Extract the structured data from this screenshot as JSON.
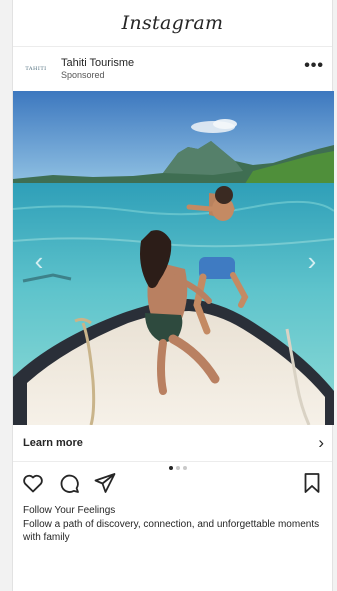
{
  "app": {
    "title": "Instagram"
  },
  "post": {
    "account_logo_text": "TAHITI",
    "account_name": "Tahiti Tourisme",
    "sponsored_label": "Sponsored",
    "more_label": "•••",
    "carousel": {
      "prev_glyph": "‹",
      "next_glyph": "›",
      "page_count": 3,
      "active_index": 0
    },
    "cta_label": "Learn more",
    "cta_chevron": "›",
    "caption_title": "Follow Your Feelings",
    "caption_body": "Follow a path of discovery, connection, and unforgettable moments with family"
  },
  "icons": {
    "like": "heart-icon",
    "comment": "comment-icon",
    "share": "paper-plane-icon",
    "save": "bookmark-icon",
    "menu": "more-icon"
  },
  "colors": {
    "text": "#262626",
    "sky_top": "#3d78bf",
    "lagoon": "#5fc4cc",
    "mountain": "#3f6e52",
    "boat": "#f3ece0"
  }
}
